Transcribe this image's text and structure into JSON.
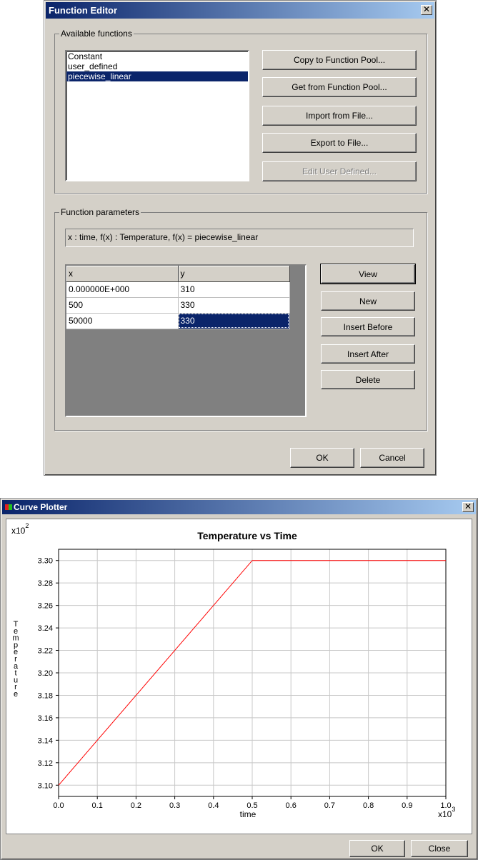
{
  "function_editor": {
    "title": "Function Editor",
    "close_glyph": "✕",
    "available_group_label": "Available functions",
    "functions": [
      "Constant",
      "user_defined",
      "piecewise_linear"
    ],
    "selected_function_index": 2,
    "buttons": {
      "copy_pool": "Copy to Function Pool...",
      "get_pool": "Get from Function Pool...",
      "import_file": "Import from File...",
      "export_file": "Export to File...",
      "edit_user": "Edit User Defined..."
    },
    "params_group_label": "Function parameters",
    "description": "x : time,   f(x) : Temperature,   f(x) = piecewise_linear",
    "table": {
      "headers": [
        "x",
        "y"
      ],
      "rows": [
        [
          "0.000000E+000",
          "310"
        ],
        [
          "500",
          "330"
        ],
        [
          "50000",
          "330"
        ]
      ]
    },
    "side_buttons": {
      "view": "View",
      "new": "New",
      "insert_before": "Insert Before",
      "insert_after": "Insert After",
      "delete": "Delete"
    },
    "ok": "OK",
    "cancel": "Cancel"
  },
  "curve_plotter": {
    "title": "Curve Plotter",
    "close_glyph": "✕",
    "ok": "OK",
    "close": "Close"
  },
  "chart_data": {
    "type": "line",
    "title": "Temperature vs Time",
    "xlabel": "time",
    "ylabel": "Temperature",
    "x_multiplier_label": "x10",
    "x_multiplier_exp": "3",
    "y_multiplier_label": "x10",
    "y_multiplier_exp": "2",
    "xlim": [
      0.0,
      1.0
    ],
    "ylim": [
      3.09,
      3.31
    ],
    "xticks": [
      "0.0",
      "0.1",
      "0.2",
      "0.3",
      "0.4",
      "0.5",
      "0.6",
      "0.7",
      "0.8",
      "0.9",
      "1.0"
    ],
    "yticks": [
      "3.10",
      "3.12",
      "3.14",
      "3.16",
      "3.18",
      "3.20",
      "3.22",
      "3.24",
      "3.26",
      "3.28",
      "3.30"
    ],
    "grid": true,
    "series": [
      {
        "color": "#ff0000",
        "x": [
          0.0,
          0.5,
          1.0
        ],
        "y": [
          3.1,
          3.3,
          3.3
        ]
      }
    ]
  }
}
